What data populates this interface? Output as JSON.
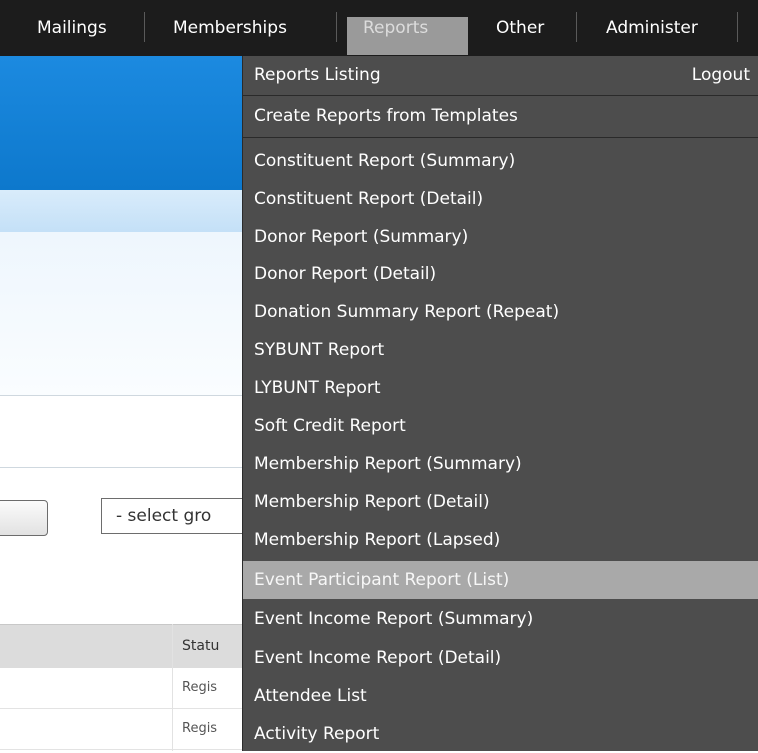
{
  "nav": {
    "items": [
      {
        "label": "Mailings"
      },
      {
        "label": "Memberships"
      },
      {
        "label": "Reports"
      },
      {
        "label": "Other"
      },
      {
        "label": "Administer"
      }
    ]
  },
  "menu": {
    "logout_label": "Logout",
    "items": [
      {
        "label": "Reports Listing"
      },
      {
        "label": "Create Reports from Templates"
      },
      {
        "label": "Constituent Report (Summary)"
      },
      {
        "label": "Constituent Report (Detail)"
      },
      {
        "label": "Donor Report (Summary)"
      },
      {
        "label": "Donor Report (Detail)"
      },
      {
        "label": "Donation Summary Report (Repeat)"
      },
      {
        "label": "SYBUNT Report"
      },
      {
        "label": "LYBUNT Report"
      },
      {
        "label": "Soft Credit Report"
      },
      {
        "label": "Membership Report (Summary)"
      },
      {
        "label": "Membership Report (Detail)"
      },
      {
        "label": "Membership Report (Lapsed)"
      },
      {
        "label": "Event Participant Report (List)"
      },
      {
        "label": "Event Income Report (Summary)"
      },
      {
        "label": "Event Income Report (Detail)"
      },
      {
        "label": "Attendee List"
      },
      {
        "label": "Activity Report"
      }
    ]
  },
  "page": {
    "group_select_value": "- select gro",
    "table": {
      "status_header": "Statu",
      "rows": [
        {
          "status": "Regis"
        },
        {
          "status": "Regis"
        }
      ]
    }
  }
}
